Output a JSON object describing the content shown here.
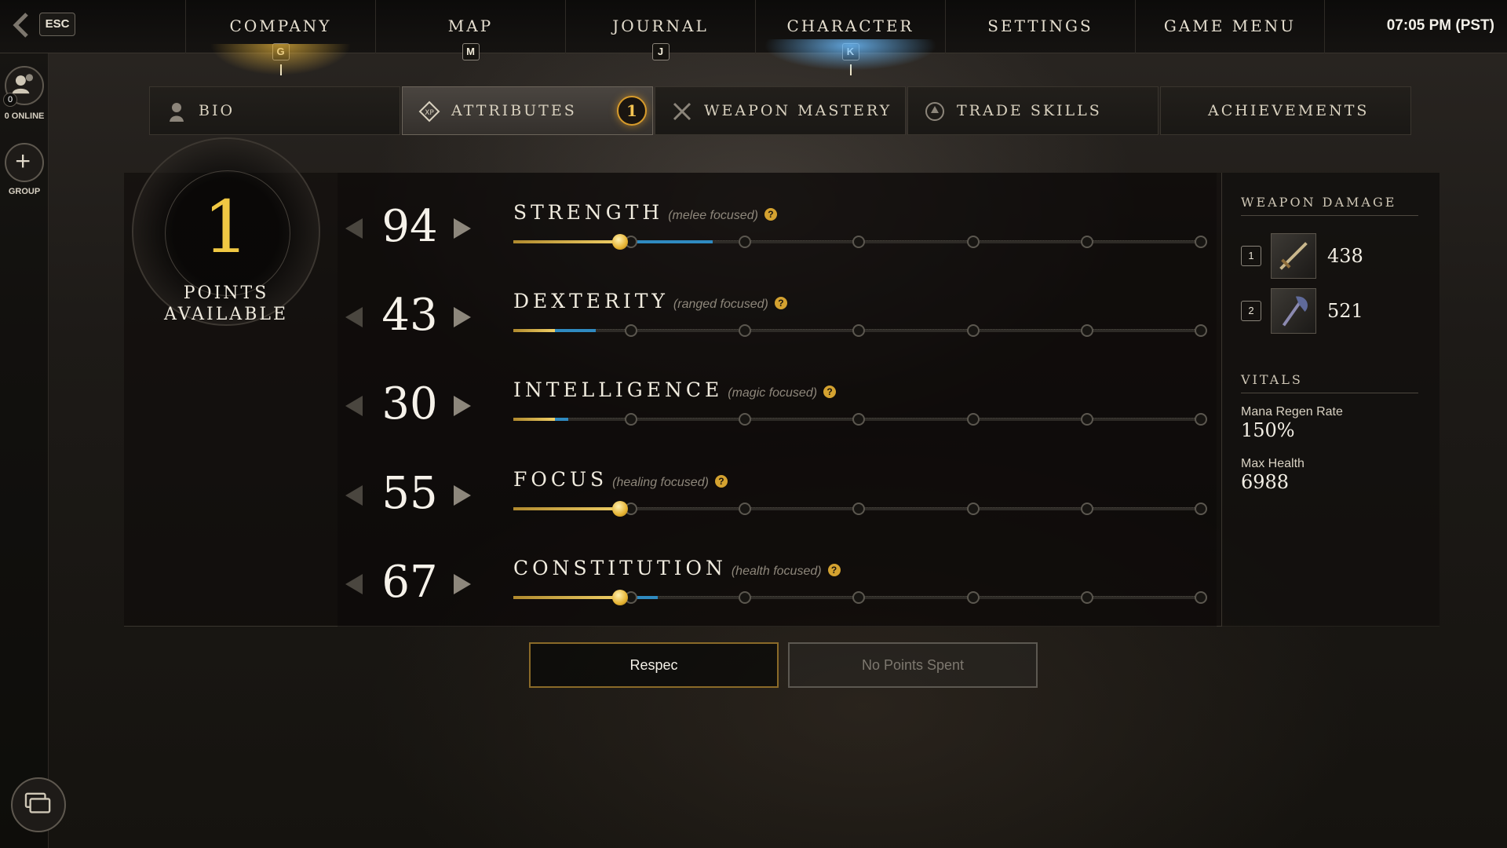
{
  "topbar": {
    "esc_label": "ESC",
    "clock": "07:05 PM  (PST)",
    "tabs": [
      {
        "label": "COMPANY",
        "key": "G"
      },
      {
        "label": "MAP",
        "key": "M"
      },
      {
        "label": "JOURNAL",
        "key": "J"
      },
      {
        "label": "CHARACTER",
        "key": "K"
      },
      {
        "label": "SETTINGS",
        "key": ""
      },
      {
        "label": "GAME MENU",
        "key": ""
      }
    ],
    "active_tab": "CHARACTER"
  },
  "left_rail": {
    "online_count": "0",
    "online_label": "0 ONLINE",
    "group_label": "GROUP",
    "icons": [
      "social-icon",
      "plus-icon",
      "chat-icon"
    ]
  },
  "subtabs": {
    "items": [
      {
        "label": "BIO",
        "icon": "person-icon"
      },
      {
        "label": "ATTRIBUTES",
        "icon": "xp-diamond-icon"
      },
      {
        "label": "WEAPON MASTERY",
        "icon": "crossed-swords-icon"
      },
      {
        "label": "TRADE SKILLS",
        "icon": "trade-icon"
      },
      {
        "label": "ACHIEVEMENTS",
        "icon": ""
      }
    ],
    "active": "ATTRIBUTES",
    "badge": "1"
  },
  "points": {
    "value": "1",
    "caption_line1": "POINTS",
    "caption_line2": "AVAILABLE"
  },
  "attributes": [
    {
      "name": "STRENGTH",
      "focus": "(melee focused)",
      "value": "94",
      "base_fraction": 0.13,
      "gold_fraction": 0.155,
      "blue_fraction": 0.29,
      "thumb_fraction": 0.155
    },
    {
      "name": "DEXTERITY",
      "focus": "(ranged focused)",
      "value": "43",
      "base_fraction": 0.06,
      "gold_fraction": 0.06,
      "blue_fraction": 0.12,
      "thumb_fraction": null
    },
    {
      "name": "INTELLIGENCE",
      "focus": "(magic focused)",
      "value": "30",
      "base_fraction": 0.06,
      "gold_fraction": 0.06,
      "blue_fraction": 0.08,
      "thumb_fraction": null
    },
    {
      "name": "FOCUS",
      "focus": "(healing focused)",
      "value": "55",
      "base_fraction": 0.13,
      "gold_fraction": 0.155,
      "blue_fraction": 0.175,
      "thumb_fraction": 0.155
    },
    {
      "name": "CONSTITUTION",
      "focus": "(health focused)",
      "value": "67",
      "base_fraction": 0.13,
      "gold_fraction": 0.155,
      "blue_fraction": 0.21,
      "thumb_fraction": 0.155
    }
  ],
  "help_glyph": "?",
  "track_nodes": 6,
  "side": {
    "weapon_heading": "WEAPON DAMAGE",
    "weapons": [
      {
        "slot": "1",
        "damage": "438",
        "icon": "sword-icon"
      },
      {
        "slot": "2",
        "damage": "521",
        "icon": "axe-icon"
      }
    ],
    "vitals_heading": "VITALS",
    "vitals": [
      {
        "label": "Mana Regen Rate",
        "value": "150%"
      },
      {
        "label": "Max Health",
        "value": "6988"
      }
    ]
  },
  "buttons": {
    "respec": "Respec",
    "no_points": "No Points Spent"
  },
  "colors": {
    "gold": "#f0c843",
    "blue": "#2f8ac0",
    "badge": "#d79b2b"
  }
}
